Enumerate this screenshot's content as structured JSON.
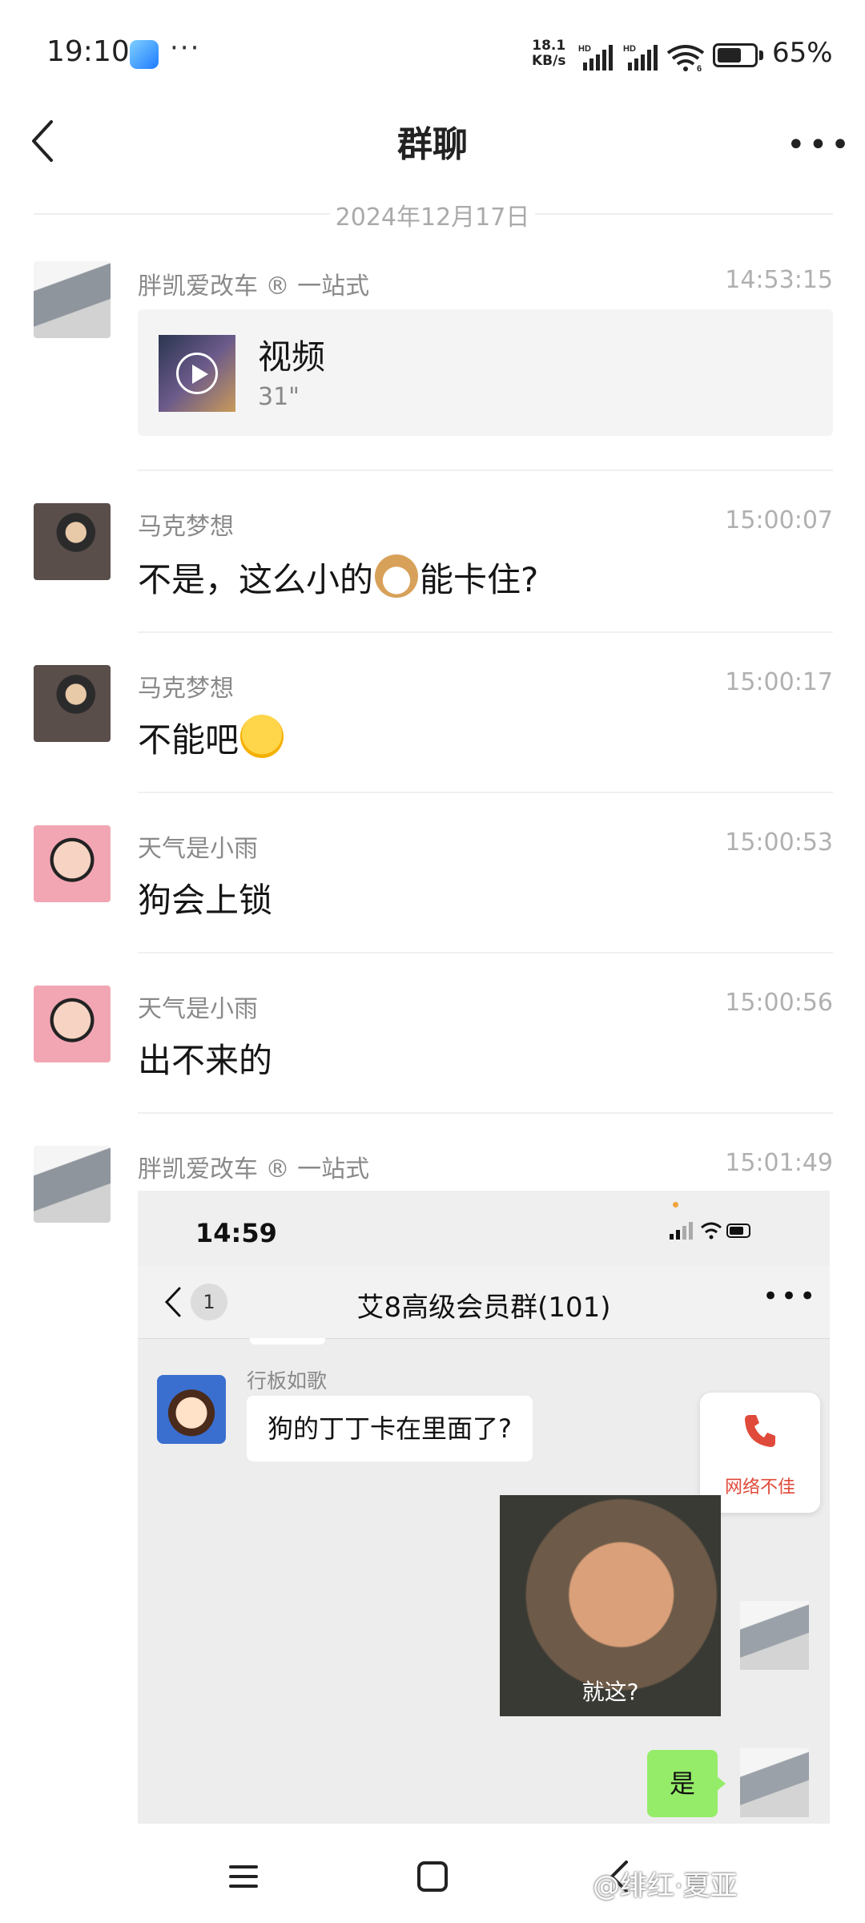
{
  "status_bar": {
    "time": "19:10",
    "dots": "···",
    "net_speed_value": "18.1",
    "net_speed_unit": "KB/s",
    "hd_label": "HD",
    "wifi_sub": "6",
    "battery_level": 0.65,
    "battery_pct": "65%"
  },
  "header": {
    "title": "群聊",
    "back_icon": "chevron-left-icon",
    "more_label": "•••"
  },
  "date_separator": "2024年12月17日",
  "messages": [
    {
      "sender": "胖凯爱改车 ® 一站式",
      "time": "14:53:15",
      "type": "video",
      "video_title": "视频",
      "video_duration": "31\""
    },
    {
      "sender": "马克梦想",
      "time": "15:00:07",
      "text_before": "不是，这么小的",
      "emoji": "dog-face-emoji",
      "text_after": "能卡住?"
    },
    {
      "sender": "马克梦想",
      "time": "15:00:17",
      "text_before": "不能吧",
      "emoji": "loudly-crying-face-emoji"
    },
    {
      "sender": "天气是小雨",
      "time": "15:00:53",
      "text": "狗会上锁"
    },
    {
      "sender": "天气是小雨",
      "time": "15:00:56",
      "text": "出不来的"
    },
    {
      "sender": "胖凯爱改车 ® 一站式",
      "time": "15:01:49",
      "type": "image"
    }
  ],
  "screenshot": {
    "time": "14:59",
    "back_badge": "1",
    "group_title": "艾8高级会员群(101)",
    "more_label": "•••",
    "sender": "行板如歌",
    "message": "狗的丁丁卡在里面了?",
    "net_notice": "网络不佳",
    "meme_caption": "就这?",
    "reply": "是"
  },
  "watermark": "@绯红·夏亚",
  "colors": {
    "accent_red": "#e04a3a",
    "bubble_green": "#95ec69"
  }
}
